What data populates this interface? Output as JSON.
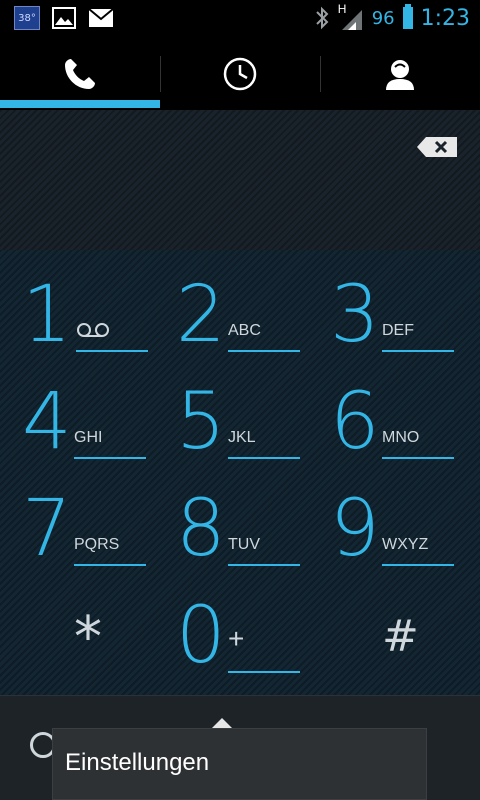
{
  "status_bar": {
    "weather_temp": "38°",
    "network_type": "H",
    "battery_percent": "96",
    "time": "1:23",
    "icons": [
      "weather-icon",
      "gallery-icon",
      "gmail-icon",
      "bluetooth-icon",
      "signal-icon",
      "battery-icon"
    ]
  },
  "tabs": [
    {
      "id": "phone",
      "icon": "phone-icon",
      "selected": true
    },
    {
      "id": "recent",
      "icon": "clock-icon",
      "selected": false
    },
    {
      "id": "contacts",
      "icon": "person-icon",
      "selected": false
    }
  ],
  "keypad": {
    "keys": [
      {
        "digit": "1",
        "letters": "",
        "voicemail": true
      },
      {
        "digit": "2",
        "letters": "ABC"
      },
      {
        "digit": "3",
        "letters": "DEF"
      },
      {
        "digit": "4",
        "letters": "GHI"
      },
      {
        "digit": "5",
        "letters": "JKL"
      },
      {
        "digit": "6",
        "letters": "MNO"
      },
      {
        "digit": "7",
        "letters": "PQRS"
      },
      {
        "digit": "8",
        "letters": "TUV"
      },
      {
        "digit": "9",
        "letters": "WXYZ"
      },
      {
        "digit": "*",
        "letters": ""
      },
      {
        "digit": "0",
        "letters": "+"
      },
      {
        "digit": "#",
        "letters": ""
      }
    ]
  },
  "menu": {
    "items": [
      {
        "label": "Einstellungen"
      }
    ]
  },
  "colors": {
    "accent": "#33b5e5",
    "keypad_bg": "#0d1c26",
    "actionbar_bg": "#1e2327"
  }
}
